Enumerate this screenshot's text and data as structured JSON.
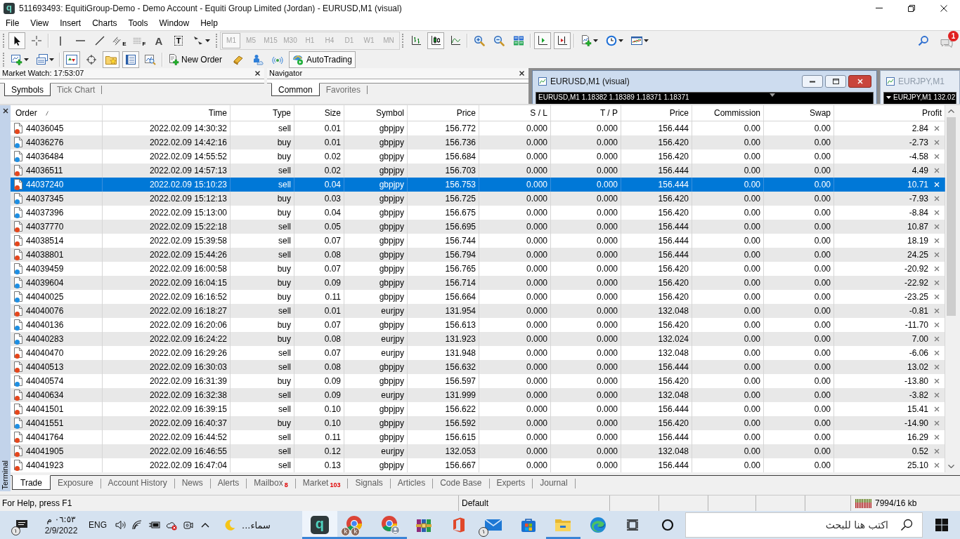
{
  "window": {
    "logo": "q",
    "title": "511693493: EquitiGroup-Demo - Demo Account - Equiti Group Limited (Jordan) - EURUSD,M1 (visual)"
  },
  "menu": [
    "File",
    "View",
    "Insert",
    "Charts",
    "Tools",
    "Window",
    "Help"
  ],
  "toolbar": {
    "drawing_tools": [
      {
        "kind": "cursor",
        "pressed": true
      },
      {
        "kind": "crosshair",
        "pressed": false
      },
      {
        "kind": "vline",
        "pressed": false
      },
      {
        "kind": "hline",
        "pressed": false
      },
      {
        "kind": "trendline",
        "pressed": false
      },
      {
        "kind": "channel",
        "pressed": false,
        "glyph": "E"
      },
      {
        "kind": "fibonacci",
        "pressed": false,
        "glyph": "F"
      },
      {
        "kind": "text",
        "pressed": false,
        "glyph": "A"
      },
      {
        "kind": "label",
        "pressed": false,
        "glyph": "T"
      },
      {
        "kind": "arrows",
        "pressed": false
      }
    ],
    "timeframes": [
      {
        "label": "M1",
        "selected": true,
        "disabled": true
      },
      {
        "label": "M5",
        "selected": false,
        "disabled": true
      },
      {
        "label": "M15",
        "selected": false,
        "disabled": true
      },
      {
        "label": "M30",
        "selected": false,
        "disabled": true
      },
      {
        "label": "H1",
        "selected": false,
        "disabled": true
      },
      {
        "label": "H4",
        "selected": false,
        "disabled": true
      },
      {
        "label": "D1",
        "selected": false,
        "disabled": true
      },
      {
        "label": "W1",
        "selected": false,
        "disabled": true
      },
      {
        "label": "MN",
        "selected": false,
        "disabled": true
      }
    ],
    "chart_tools": [
      {
        "kind": "bars",
        "pressed": false
      },
      {
        "kind": "candles",
        "pressed": true
      },
      {
        "kind": "line",
        "pressed": false
      },
      {
        "kind": "zoomin",
        "pressed": false
      },
      {
        "kind": "zoomout",
        "pressed": false
      },
      {
        "kind": "tile",
        "pressed": false
      },
      {
        "kind": "shift",
        "pressed": true
      },
      {
        "kind": "autoscroll",
        "pressed": true
      },
      {
        "kind": "indicators",
        "pressed": false
      },
      {
        "kind": "periods",
        "pressed": false
      },
      {
        "kind": "templates",
        "pressed": false
      }
    ],
    "notifications": "1"
  },
  "standard_toolbar": {
    "tools": [
      {
        "kind": "newchart",
        "pressed": false
      },
      {
        "kind": "profiles",
        "pressed": false
      },
      {
        "kind": "marketwatch",
        "pressed": true
      },
      {
        "kind": "datawindow",
        "pressed": false
      },
      {
        "kind": "navigator",
        "pressed": true
      },
      {
        "kind": "terminal",
        "pressed": true
      },
      {
        "kind": "tester",
        "pressed": false
      }
    ],
    "new_order": "New Order",
    "autotrading": {
      "label": "AutoTrading",
      "pressed": true
    }
  },
  "market_watch": {
    "title": "Market Watch: 17:53:07",
    "tabs": [
      {
        "label": "Symbols",
        "selected": true
      },
      {
        "label": "Tick Chart",
        "selected": false
      }
    ]
  },
  "navigator": {
    "title": "Navigator",
    "tabs": [
      {
        "label": "Common",
        "selected": true
      },
      {
        "label": "Favorites",
        "selected": false
      }
    ]
  },
  "chart_windows": [
    {
      "title": "EURUSD,M1 (visual)",
      "active": true,
      "info": "EURUSD,M1 1.18382 1.18389 1.18371 1.18371"
    },
    {
      "title": "EURJPY,M1",
      "active": false,
      "info": "EURJPY,M1 132.02"
    }
  ],
  "terminal": {
    "label": "Terminal",
    "columns": [
      "Order",
      "Time",
      "Type",
      "Size",
      "Symbol",
      "Price",
      "S / L",
      "T / P",
      "Price",
      "Commission",
      "Swap",
      "Profit"
    ],
    "rows": [
      {
        "order": "44036045",
        "time": "2022.02.09 14:30:32",
        "type": "sell",
        "size": "0.01",
        "symbol": "gbpjpy",
        "open_price": "156.772",
        "sl": "0.000",
        "tp": "0.000",
        "price": "156.444",
        "commission": "0.00",
        "swap": "0.00",
        "profit": "2.84",
        "color": "#e5461c",
        "selected": false
      },
      {
        "order": "44036276",
        "time": "2022.02.09 14:42:16",
        "type": "buy",
        "size": "0.01",
        "symbol": "gbpjpy",
        "open_price": "156.736",
        "sl": "0.000",
        "tp": "0.000",
        "price": "156.420",
        "commission": "0.00",
        "swap": "0.00",
        "profit": "-2.73",
        "color": "#1e8fe3",
        "selected": false
      },
      {
        "order": "44036484",
        "time": "2022.02.09 14:55:52",
        "type": "buy",
        "size": "0.02",
        "symbol": "gbpjpy",
        "open_price": "156.684",
        "sl": "0.000",
        "tp": "0.000",
        "price": "156.420",
        "commission": "0.00",
        "swap": "0.00",
        "profit": "-4.58",
        "color": "#1e8fe3",
        "selected": false
      },
      {
        "order": "44036511",
        "time": "2022.02.09 14:57:13",
        "type": "sell",
        "size": "0.02",
        "symbol": "gbpjpy",
        "open_price": "156.703",
        "sl": "0.000",
        "tp": "0.000",
        "price": "156.444",
        "commission": "0.00",
        "swap": "0.00",
        "profit": "4.49",
        "color": "#e5461c",
        "selected": false
      },
      {
        "order": "44037240",
        "time": "2022.02.09 15:10:23",
        "type": "sell",
        "size": "0.04",
        "symbol": "gbpjpy",
        "open_price": "156.753",
        "sl": "0.000",
        "tp": "0.000",
        "price": "156.444",
        "commission": "0.00",
        "swap": "0.00",
        "profit": "10.71",
        "color": "#e5461c",
        "selected": true
      },
      {
        "order": "44037345",
        "time": "2022.02.09 15:12:13",
        "type": "buy",
        "size": "0.03",
        "symbol": "gbpjpy",
        "open_price": "156.725",
        "sl": "0.000",
        "tp": "0.000",
        "price": "156.420",
        "commission": "0.00",
        "swap": "0.00",
        "profit": "-7.93",
        "color": "#1e8fe3",
        "selected": false
      },
      {
        "order": "44037396",
        "time": "2022.02.09 15:13:00",
        "type": "buy",
        "size": "0.04",
        "symbol": "gbpjpy",
        "open_price": "156.675",
        "sl": "0.000",
        "tp": "0.000",
        "price": "156.420",
        "commission": "0.00",
        "swap": "0.00",
        "profit": "-8.84",
        "color": "#1e8fe3",
        "selected": false
      },
      {
        "order": "44037770",
        "time": "2022.02.09 15:22:18",
        "type": "sell",
        "size": "0.05",
        "symbol": "gbpjpy",
        "open_price": "156.695",
        "sl": "0.000",
        "tp": "0.000",
        "price": "156.444",
        "commission": "0.00",
        "swap": "0.00",
        "profit": "10.87",
        "color": "#e5461c",
        "selected": false
      },
      {
        "order": "44038514",
        "time": "2022.02.09 15:39:58",
        "type": "sell",
        "size": "0.07",
        "symbol": "gbpjpy",
        "open_price": "156.744",
        "sl": "0.000",
        "tp": "0.000",
        "price": "156.444",
        "commission": "0.00",
        "swap": "0.00",
        "profit": "18.19",
        "color": "#e5461c",
        "selected": false
      },
      {
        "order": "44038801",
        "time": "2022.02.09 15:44:26",
        "type": "sell",
        "size": "0.08",
        "symbol": "gbpjpy",
        "open_price": "156.794",
        "sl": "0.000",
        "tp": "0.000",
        "price": "156.444",
        "commission": "0.00",
        "swap": "0.00",
        "profit": "24.25",
        "color": "#e5461c",
        "selected": false
      },
      {
        "order": "44039459",
        "time": "2022.02.09 16:00:58",
        "type": "buy",
        "size": "0.07",
        "symbol": "gbpjpy",
        "open_price": "156.765",
        "sl": "0.000",
        "tp": "0.000",
        "price": "156.420",
        "commission": "0.00",
        "swap": "0.00",
        "profit": "-20.92",
        "color": "#1e8fe3",
        "selected": false
      },
      {
        "order": "44039604",
        "time": "2022.02.09 16:04:15",
        "type": "buy",
        "size": "0.09",
        "symbol": "gbpjpy",
        "open_price": "156.714",
        "sl": "0.000",
        "tp": "0.000",
        "price": "156.420",
        "commission": "0.00",
        "swap": "0.00",
        "profit": "-22.92",
        "color": "#1e8fe3",
        "selected": false
      },
      {
        "order": "44040025",
        "time": "2022.02.09 16:16:52",
        "type": "buy",
        "size": "0.11",
        "symbol": "gbpjpy",
        "open_price": "156.664",
        "sl": "0.000",
        "tp": "0.000",
        "price": "156.420",
        "commission": "0.00",
        "swap": "0.00",
        "profit": "-23.25",
        "color": "#1e8fe3",
        "selected": false
      },
      {
        "order": "44040076",
        "time": "2022.02.09 16:18:27",
        "type": "sell",
        "size": "0.01",
        "symbol": "eurjpy",
        "open_price": "131.954",
        "sl": "0.000",
        "tp": "0.000",
        "price": "132.048",
        "commission": "0.00",
        "swap": "0.00",
        "profit": "-0.81",
        "color": "#e5461c",
        "selected": false
      },
      {
        "order": "44040136",
        "time": "2022.02.09 16:20:06",
        "type": "buy",
        "size": "0.07",
        "symbol": "gbpjpy",
        "open_price": "156.613",
        "sl": "0.000",
        "tp": "0.000",
        "price": "156.420",
        "commission": "0.00",
        "swap": "0.00",
        "profit": "-11.70",
        "color": "#1e8fe3",
        "selected": false
      },
      {
        "order": "44040283",
        "time": "2022.02.09 16:24:22",
        "type": "buy",
        "size": "0.08",
        "symbol": "eurjpy",
        "open_price": "131.923",
        "sl": "0.000",
        "tp": "0.000",
        "price": "132.024",
        "commission": "0.00",
        "swap": "0.00",
        "profit": "7.00",
        "color": "#1e8fe3",
        "selected": false
      },
      {
        "order": "44040470",
        "time": "2022.02.09 16:29:26",
        "type": "sell",
        "size": "0.07",
        "symbol": "eurjpy",
        "open_price": "131.948",
        "sl": "0.000",
        "tp": "0.000",
        "price": "132.048",
        "commission": "0.00",
        "swap": "0.00",
        "profit": "-6.06",
        "color": "#e5461c",
        "selected": false
      },
      {
        "order": "44040513",
        "time": "2022.02.09 16:30:03",
        "type": "sell",
        "size": "0.08",
        "symbol": "gbpjpy",
        "open_price": "156.632",
        "sl": "0.000",
        "tp": "0.000",
        "price": "156.444",
        "commission": "0.00",
        "swap": "0.00",
        "profit": "13.02",
        "color": "#e5461c",
        "selected": false
      },
      {
        "order": "44040574",
        "time": "2022.02.09 16:31:39",
        "type": "buy",
        "size": "0.09",
        "symbol": "gbpjpy",
        "open_price": "156.597",
        "sl": "0.000",
        "tp": "0.000",
        "price": "156.420",
        "commission": "0.00",
        "swap": "0.00",
        "profit": "-13.80",
        "color": "#1e8fe3",
        "selected": false
      },
      {
        "order": "44040634",
        "time": "2022.02.09 16:32:38",
        "type": "sell",
        "size": "0.09",
        "symbol": "eurjpy",
        "open_price": "131.999",
        "sl": "0.000",
        "tp": "0.000",
        "price": "132.048",
        "commission": "0.00",
        "swap": "0.00",
        "profit": "-3.82",
        "color": "#e5461c",
        "selected": false
      },
      {
        "order": "44041501",
        "time": "2022.02.09 16:39:15",
        "type": "sell",
        "size": "0.10",
        "symbol": "gbpjpy",
        "open_price": "156.622",
        "sl": "0.000",
        "tp": "0.000",
        "price": "156.444",
        "commission": "0.00",
        "swap": "0.00",
        "profit": "15.41",
        "color": "#e5461c",
        "selected": false
      },
      {
        "order": "44041551",
        "time": "2022.02.09 16:40:37",
        "type": "buy",
        "size": "0.10",
        "symbol": "gbpjpy",
        "open_price": "156.592",
        "sl": "0.000",
        "tp": "0.000",
        "price": "156.420",
        "commission": "0.00",
        "swap": "0.00",
        "profit": "-14.90",
        "color": "#1e8fe3",
        "selected": false
      },
      {
        "order": "44041764",
        "time": "2022.02.09 16:44:52",
        "type": "sell",
        "size": "0.11",
        "symbol": "gbpjpy",
        "open_price": "156.615",
        "sl": "0.000",
        "tp": "0.000",
        "price": "156.444",
        "commission": "0.00",
        "swap": "0.00",
        "profit": "16.29",
        "color": "#e5461c",
        "selected": false
      },
      {
        "order": "44041905",
        "time": "2022.02.09 16:46:55",
        "type": "sell",
        "size": "0.12",
        "symbol": "eurjpy",
        "open_price": "132.053",
        "sl": "0.000",
        "tp": "0.000",
        "price": "132.048",
        "commission": "0.00",
        "swap": "0.00",
        "profit": "0.52",
        "color": "#e5461c",
        "selected": false
      },
      {
        "order": "44041923",
        "time": "2022.02.09 16:47:04",
        "type": "sell",
        "size": "0.13",
        "symbol": "gbpjpy",
        "open_price": "156.667",
        "sl": "0.000",
        "tp": "0.000",
        "price": "156.444",
        "commission": "0.00",
        "swap": "0.00",
        "profit": "25.10",
        "color": "#e5461c",
        "selected": false
      }
    ],
    "tabs": [
      {
        "label": "Trade",
        "selected": true
      },
      {
        "label": "Exposure",
        "selected": false
      },
      {
        "label": "Account History",
        "selected": false
      },
      {
        "label": "News",
        "selected": false
      },
      {
        "label": "Alerts",
        "selected": false
      },
      {
        "label": "Mailbox",
        "selected": false,
        "badge": "8"
      },
      {
        "label": "Market",
        "selected": false,
        "badge": "103"
      },
      {
        "label": "Signals",
        "selected": false
      },
      {
        "label": "Articles",
        "selected": false
      },
      {
        "label": "Code Base",
        "selected": false
      },
      {
        "label": "Experts",
        "selected": false
      },
      {
        "label": "Journal",
        "selected": false
      }
    ]
  },
  "status_bar": {
    "help": "For Help, press F1",
    "profile": "Default",
    "traffic": "7994/16 kb"
  },
  "taskbar": {
    "notifications": "١",
    "time": "٠٦:٥٣ م",
    "date": "2/9/2022",
    "language": "ENG",
    "weather": "سماء...",
    "apps": [
      {
        "kind": "logo",
        "logo": "q",
        "selected": true,
        "running": true
      },
      {
        "kind": "browser",
        "avatars": [
          "k",
          "k"
        ],
        "selected": false,
        "running": true
      },
      {
        "kind": "guestbrowser",
        "selected": false,
        "running": true
      },
      {
        "kind": "archive",
        "selected": false,
        "running": false
      },
      {
        "kind": "office",
        "selected": false,
        "running": false
      },
      {
        "kind": "mail",
        "badge": "١",
        "selected": false,
        "running": false
      },
      {
        "kind": "store",
        "selected": false,
        "running": false
      },
      {
        "kind": "folder",
        "selected": false,
        "running": true
      },
      {
        "kind": "edge",
        "selected": false,
        "running": false
      }
    ],
    "search_placeholder": "اكتب هنا للبحث"
  }
}
